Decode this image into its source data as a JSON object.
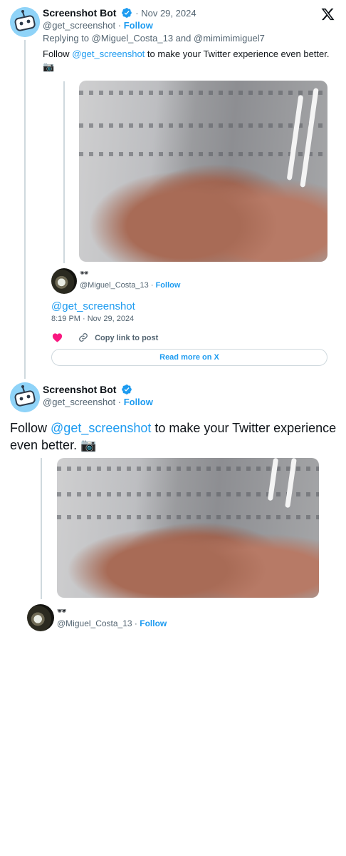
{
  "colors": {
    "link": "#1d9bf0",
    "muted": "#536471",
    "text": "#0f1419",
    "heart": "#f91880",
    "border": "#cfd9de"
  },
  "embed": {
    "author_name": "Screenshot Bot",
    "handle": "@get_screenshot",
    "dot": "·",
    "date": "Nov 29, 2024",
    "follow_label": "Follow",
    "reply_prefix": "Replying to",
    "reply_user1": "@Miguel_Costa_13",
    "reply_and": "and",
    "reply_user2": "@mimimimiguel7",
    "text_before": "Follow",
    "mention": "@get_screenshot",
    "text_after": "to make your Twitter experience even better.",
    "emoji": "📷",
    "quoted": {
      "author_emoji": "🕶",
      "handle": "@Miguel_Costa_13",
      "follow_label": "Follow",
      "text": "@get_screenshot",
      "time": "8:19 PM · Nov 29, 2024"
    },
    "copy_link_label": "Copy link to post",
    "read_more_label": "Read more on X"
  },
  "tweet": {
    "author_name": "Screenshot Bot",
    "handle": "@get_screenshot",
    "dot": "·",
    "follow_label": "Follow",
    "text_before": "Follow",
    "mention": "@get_screenshot",
    "text_after": "to make your Twitter experience",
    "text_line2": "even better.",
    "emoji": "📷",
    "quoted": {
      "author_emoji": "🕶",
      "handle": "@Miguel_Costa_13",
      "follow_label": "Follow"
    }
  }
}
